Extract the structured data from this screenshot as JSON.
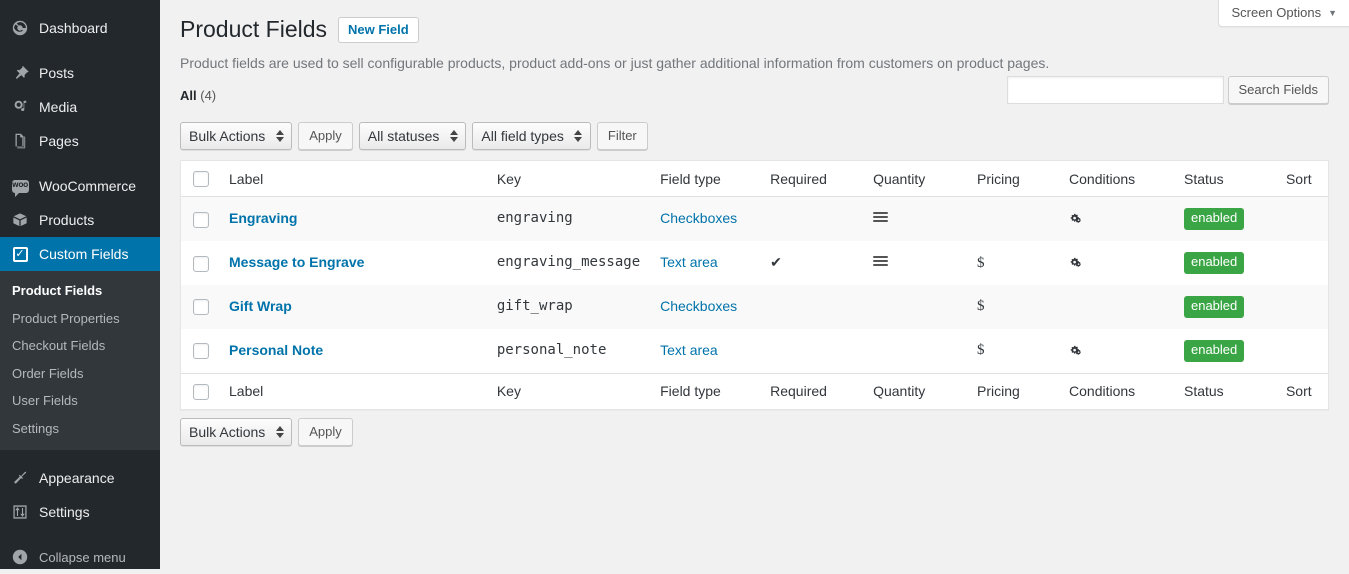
{
  "sidebar": {
    "items": [
      {
        "label": "Dashboard",
        "icon": "dashboard-icon"
      },
      {
        "label": "Posts",
        "icon": "pin-icon"
      },
      {
        "label": "Media",
        "icon": "media-icon"
      },
      {
        "label": "Pages",
        "icon": "pages-icon"
      },
      {
        "label": "WooCommerce",
        "icon": "woocommerce-icon"
      },
      {
        "label": "Products",
        "icon": "products-box-icon"
      },
      {
        "label": "Custom Fields",
        "icon": "custom-fields-check-icon"
      },
      {
        "label": "Appearance",
        "icon": "appearance-brush-icon"
      },
      {
        "label": "Settings",
        "icon": "settings-sliders-icon"
      },
      {
        "label": "Collapse menu",
        "icon": "collapse-arrow-icon"
      }
    ],
    "woo_glyph": "WOO",
    "submenu": [
      {
        "label": "Product Fields",
        "current": true
      },
      {
        "label": "Product Properties",
        "current": false
      },
      {
        "label": "Checkout Fields",
        "current": false
      },
      {
        "label": "Order Fields",
        "current": false
      },
      {
        "label": "User Fields",
        "current": false
      },
      {
        "label": "Settings",
        "current": false
      }
    ],
    "active_index": 6,
    "accent_color": "#0073aa"
  },
  "screen_options": {
    "label": "Screen Options",
    "caret": "▼"
  },
  "header": {
    "title": "Product Fields",
    "new_field_button": "New Field",
    "description": "Product fields are used to sell configurable products, product add-ons or just gather additional information from customers on product pages."
  },
  "views": {
    "all_label": "All",
    "all_count": "(4)"
  },
  "search": {
    "value": "",
    "placeholder": "",
    "button": "Search Fields"
  },
  "tablenav_top": {
    "bulk_actions": "Bulk Actions",
    "apply": "Apply",
    "status_filter": "All statuses",
    "field_type_filter": "All field types",
    "filter_button": "Filter"
  },
  "tablenav_bottom": {
    "bulk_actions": "Bulk Actions",
    "apply": "Apply"
  },
  "table": {
    "columns": [
      "Label",
      "Key",
      "Field type",
      "Required",
      "Quantity",
      "Pricing",
      "Conditions",
      "Status",
      "Sort"
    ],
    "rows": [
      {
        "label": "Engraving",
        "key": "engraving",
        "field_type": "Checkboxes",
        "required": false,
        "quantity": true,
        "pricing": false,
        "conditions": true,
        "status": "enabled",
        "sort": ""
      },
      {
        "label": "Message to Engrave",
        "key": "engraving_message",
        "field_type": "Text area",
        "required": true,
        "quantity": true,
        "pricing": true,
        "conditions": true,
        "status": "enabled",
        "sort": ""
      },
      {
        "label": "Gift Wrap",
        "key": "gift_wrap",
        "field_type": "Checkboxes",
        "required": false,
        "quantity": false,
        "pricing": true,
        "conditions": false,
        "status": "enabled",
        "sort": ""
      },
      {
        "label": "Personal Note",
        "key": "personal_note",
        "field_type": "Text area",
        "required": false,
        "quantity": false,
        "pricing": true,
        "conditions": true,
        "status": "enabled",
        "sort": ""
      }
    ]
  },
  "icons": {
    "required_check": "✔",
    "pricing_dollar": "$",
    "quantity": "quantity-lines-icon",
    "conditions": "gears-icon"
  },
  "colors": {
    "admin_bg": "#23282d",
    "submenu_bg": "#32373c",
    "accent": "#0073aa",
    "link": "#0073aa",
    "badge_green": "#3aa545",
    "content_bg": "#f1f1f1"
  }
}
